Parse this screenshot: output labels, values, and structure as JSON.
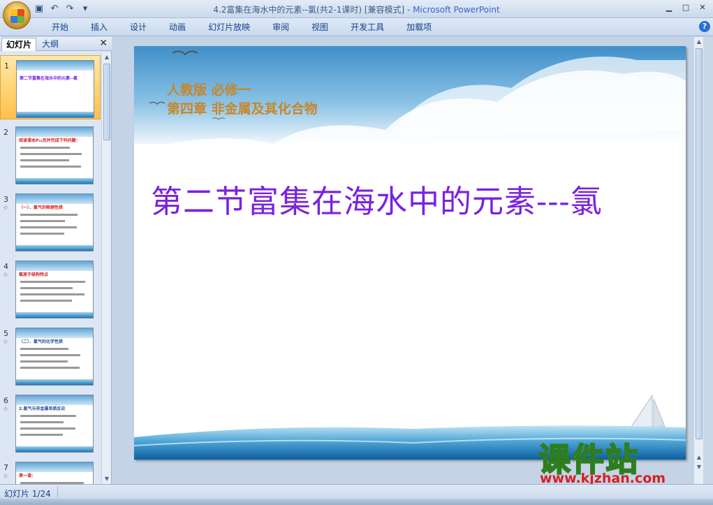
{
  "window": {
    "title": "4.2富集在海水中的元素--氯(共2-1课时) [兼容模式] - ",
    "app_name": "Microsoft PowerPoint"
  },
  "quick_access": {
    "save_icon": "save-icon",
    "undo_icon": "undo-icon",
    "redo_icon": "redo-icon"
  },
  "ribbon": {
    "tabs": [
      "开始",
      "插入",
      "设计",
      "动画",
      "幻灯片放映",
      "审阅",
      "视图",
      "开发工具",
      "加载项"
    ]
  },
  "left_pane": {
    "tab_slides": "幻灯片",
    "tab_outline": "大纲",
    "thumbnails": [
      {
        "num": "1",
        "anim": "",
        "title": "第二节富集在海水中的元素--氯"
      },
      {
        "num": "2",
        "anim": "",
        "title": "阅读课本P₈₂页并完成下列问题："
      },
      {
        "num": "3",
        "anim": "☆",
        "title": "（一）、氯气的物理性质"
      },
      {
        "num": "4",
        "anim": "☆",
        "title": "氯原子结构特点"
      },
      {
        "num": "5",
        "anim": "☆",
        "title": "（二）、氯气的化学性质"
      },
      {
        "num": "6",
        "anim": "☆",
        "title": "2.氯气与非金属单质反应"
      },
      {
        "num": "7",
        "anim": "☆",
        "title": "第一课："
      }
    ]
  },
  "slide": {
    "subtitle1": "人教版  必修一",
    "subtitle2": "第四章  非金属及其化合物",
    "title": "第二节富集在海水中的元素---氯"
  },
  "watermark": {
    "text": "课件站",
    "url": "www.kjzhan.com"
  },
  "status": {
    "slide_counter": "幻灯片 1/24"
  },
  "colors": {
    "title_purple": "#7a22e0",
    "subtitle_gold": "#c8862a"
  }
}
